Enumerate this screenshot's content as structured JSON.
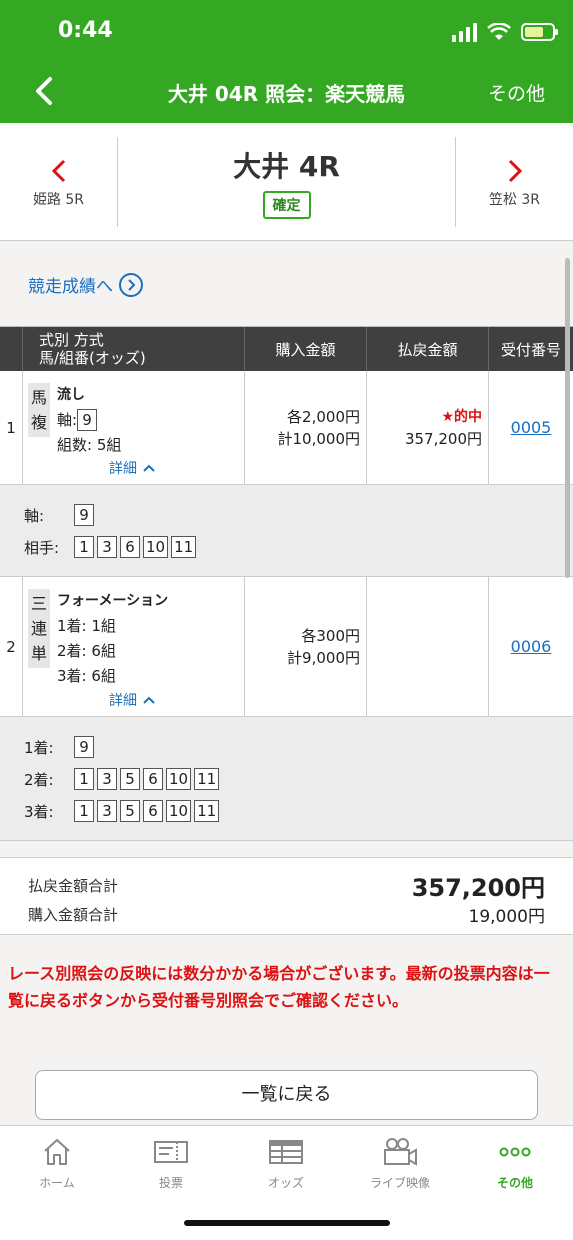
{
  "status": {
    "time": "0:44"
  },
  "nav": {
    "title": "大井 04R 照会：楽天競馬",
    "other": "その他",
    "back_icon": "chevron-left-icon"
  },
  "race": {
    "prev_label": "姫路 5R",
    "current_name": "大井 4R",
    "status_badge": "確定",
    "next_label": "笠松 3R"
  },
  "result_link": "競走成績へ",
  "table": {
    "headers": {
      "type_line1": "式別 方式",
      "type_line2": "馬/組番(オッズ)",
      "buy": "購入金額",
      "pay": "払戻金額",
      "receipt": "受付番号"
    },
    "rows": [
      {
        "index": "1",
        "kind_chars": [
          "馬",
          "複"
        ],
        "method": "流し",
        "axis_label": "軸:",
        "axis_value": "9",
        "combo_count": "組数: 5組",
        "detail_label": "詳細",
        "buy_each": "各2,000円",
        "buy_total": "計10,000円",
        "pay_status": "的中",
        "pay_amount": "357,200円",
        "receipt": "0005",
        "details": {
          "axis_label": "軸:",
          "axis": [
            "9"
          ],
          "partner_label": "相手:",
          "partners": [
            "1",
            "3",
            "6",
            "10",
            "11"
          ]
        }
      },
      {
        "index": "2",
        "kind_chars": [
          "三",
          "連",
          "単"
        ],
        "method": "フォーメーション",
        "line1": "1着: 1組",
        "line2": "2着: 6組",
        "line3": "3着: 6組",
        "detail_label": "詳細",
        "buy_each": "各300円",
        "buy_total": "計9,000円",
        "receipt": "0006",
        "details": {
          "first_label": "1着:",
          "first": [
            "9"
          ],
          "second_label": "2着:",
          "second": [
            "1",
            "3",
            "5",
            "6",
            "10",
            "11"
          ],
          "third_label": "3着:",
          "third": [
            "1",
            "3",
            "5",
            "6",
            "10",
            "11"
          ]
        }
      }
    ]
  },
  "totals": {
    "payout_label": "払戻金額合計",
    "payout_value": "357,200円",
    "purchase_label": "購入金額合計",
    "purchase_value": "19,000円"
  },
  "notice": "レース別照会の反映には数分かかる場合がございます。最新の投票内容は一覧に戻るボタンから受付番号別照会でご確認ください。",
  "back_button": "一覧に戻る",
  "tabs": [
    {
      "label": "ホーム",
      "icon": "home-icon"
    },
    {
      "label": "投票",
      "icon": "ticket-icon"
    },
    {
      "label": "オッズ",
      "icon": "odds-table-icon"
    },
    {
      "label": "ライブ映像",
      "icon": "video-camera-icon"
    },
    {
      "label": "その他",
      "icon": "more-dots-icon"
    }
  ],
  "colors": {
    "brand_green": "#35a823",
    "link_blue": "#1a6fbf",
    "alert_red": "#d11111"
  }
}
